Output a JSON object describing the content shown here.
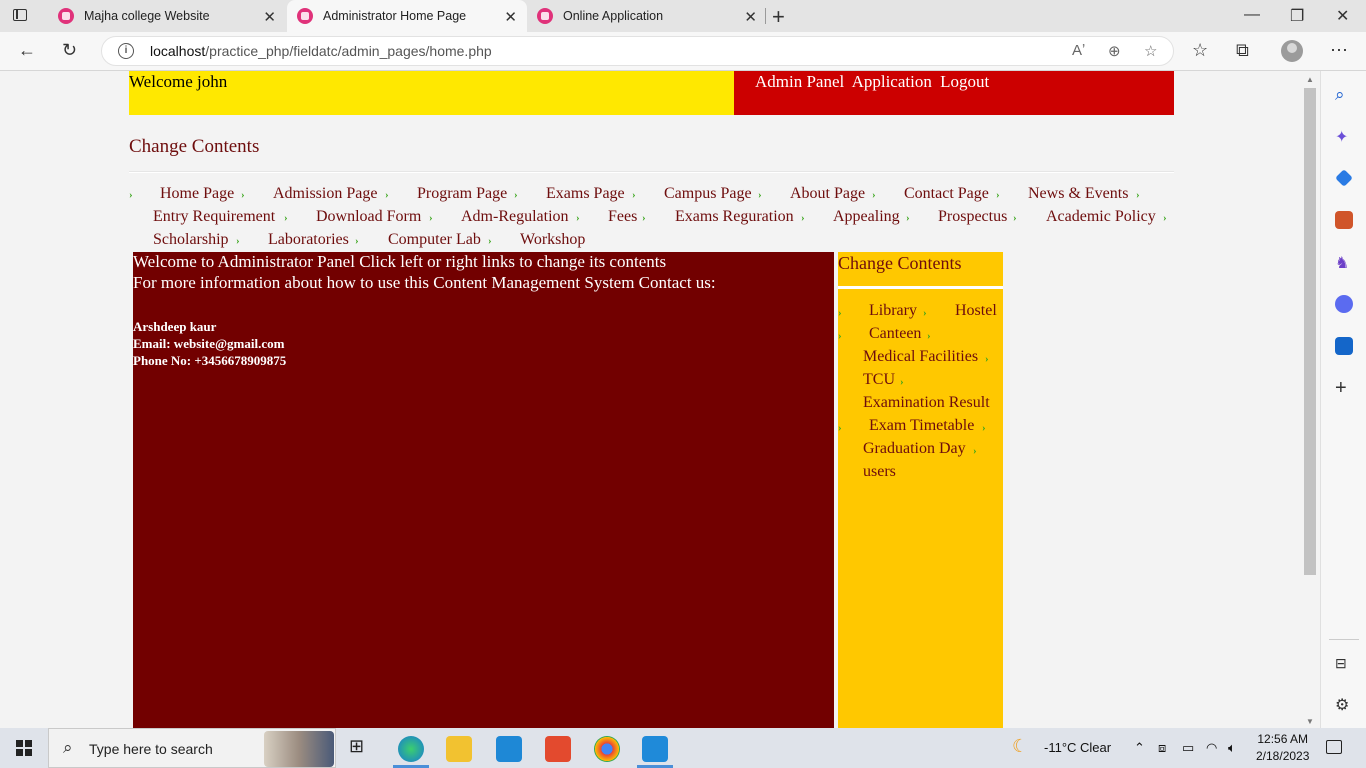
{
  "browser": {
    "tabs": [
      {
        "title": "Majha college Website",
        "active": false
      },
      {
        "title": "Administrator Home Page",
        "active": true
      },
      {
        "title": "Online Application",
        "active": false
      }
    ],
    "url_host": "localhost",
    "url_path": "/practice_php/fieldatc/admin_pages/home.php",
    "colors": {
      "tab_favicon": "#e0327a"
    }
  },
  "header": {
    "welcome": "Welcome john",
    "admin_panel": "Admin Panel",
    "application": "Application",
    "logout": "Logout"
  },
  "change_contents": {
    "title": "Change Contents"
  },
  "menu": {
    "items": [
      "Home Page",
      "Admission Page",
      "Program Page",
      "Exams Page",
      "Campus Page",
      "About Page",
      "Contact Page",
      "News & Events",
      "Entry Requirement",
      "Download Form",
      "Adm-Regulation",
      "Fees",
      "Exams Reguration",
      "Appealing",
      "Prospectus",
      "Academic Policy",
      "Scholarship",
      "Laboratories",
      "Computer Lab",
      "Workshop"
    ]
  },
  "main": {
    "line1": "Welcome to Administrator Panel Click left or right links to change its contents",
    "line2": "For more information about how to use this Content Management System Contact us:",
    "contact_name": "Arshdeep kaur",
    "contact_email": "Email: website@gmail.com",
    "contact_phone": "Phone No: +3456678909875"
  },
  "side": {
    "title": "Change Contents",
    "items": [
      "Library",
      "Hostel",
      "Canteen",
      "Medical Facilities",
      "TCU",
      "Examination Result",
      "Exam Timetable",
      "Graduation Day",
      "users"
    ]
  },
  "taskbar": {
    "search_placeholder": "Type here to search",
    "weather": "-11°C  Clear",
    "time": "12:56 AM",
    "date": "2/18/2023"
  },
  "theme": {
    "yellow": "#ffe800",
    "red": "#cc0000",
    "maroon": "#720000",
    "gold": "#ffc800",
    "text_maroon": "#6e0d0d",
    "arrow_green": "#3aa51c"
  }
}
